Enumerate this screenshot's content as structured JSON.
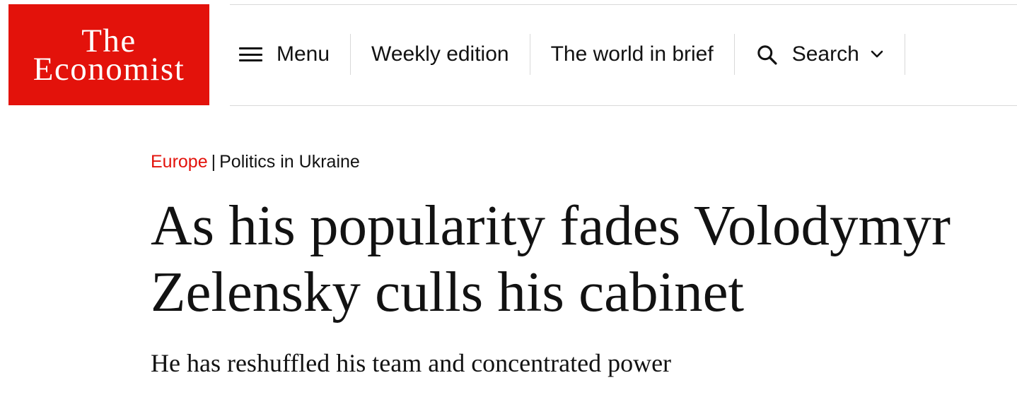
{
  "brand": {
    "logo_line1": "The",
    "logo_line2": "Economist",
    "color": "#e3120b"
  },
  "nav": {
    "menu": {
      "label": "Menu",
      "icon": "hamburger-menu-icon"
    },
    "weekly_edition": "Weekly edition",
    "world_in_brief": "The world in brief",
    "search": {
      "label": "Search",
      "icon": "search-icon",
      "dropdown_icon": "chevron-down-icon"
    }
  },
  "article": {
    "section": "Europe",
    "separator": "|",
    "topic": "Politics in Ukraine",
    "headline": "As his popularity fades Volodymyr Zelensky culls his cabinet",
    "standfirst": "He has reshuffled his team and concentrated power"
  }
}
